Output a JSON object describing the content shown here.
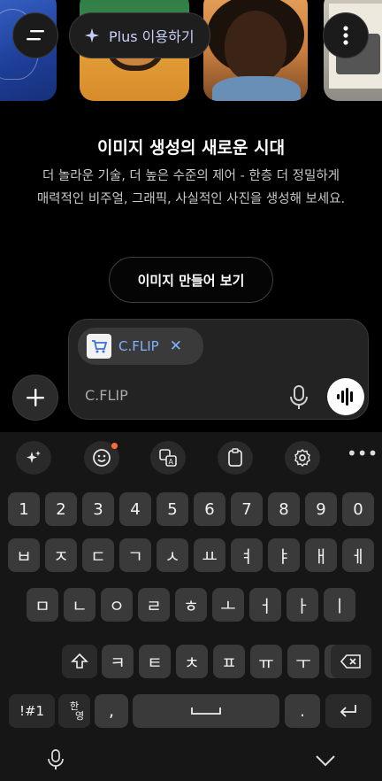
{
  "header": {
    "plus_label": "Plus 이용하기"
  },
  "hero": {
    "title": "이미지 생성의 새로운 시대",
    "description": "더 놀라운 기술, 더 높은 수준의 제어 - 한층 더 정밀하게 매력적인 비주얼, 그래픽, 사실적인 사진을 생성해 보세요.",
    "cta_label": "이미지 만들어 보기"
  },
  "composer": {
    "attachment_label": "C.FLIP",
    "input_value": "C.FLIP"
  },
  "keyboard": {
    "number_row": [
      "1",
      "2",
      "3",
      "4",
      "5",
      "6",
      "7",
      "8",
      "9",
      "0"
    ],
    "row1": [
      "ㅂ",
      "ㅈ",
      "ㄷ",
      "ㄱ",
      "ㅅ",
      "ㅛ",
      "ㅕ",
      "ㅑ",
      "ㅐ",
      "ㅔ"
    ],
    "row2": [
      "ㅁ",
      "ㄴ",
      "ㅇ",
      "ㄹ",
      "ㅎ",
      "ㅗ",
      "ㅓ",
      "ㅏ",
      "ㅣ"
    ],
    "row3": [
      "ㅋ",
      "ㅌ",
      "ㅊ",
      "ㅍ",
      "ㅠ",
      "ㅜ",
      "ㅡ"
    ],
    "symbols_label": "!#1",
    "lang_top": "한",
    "lang_bottom": "영",
    "comma": ",",
    "period": "."
  },
  "colors": {
    "link": "#7db3ff",
    "notification_dot": "#ff6a3d"
  }
}
